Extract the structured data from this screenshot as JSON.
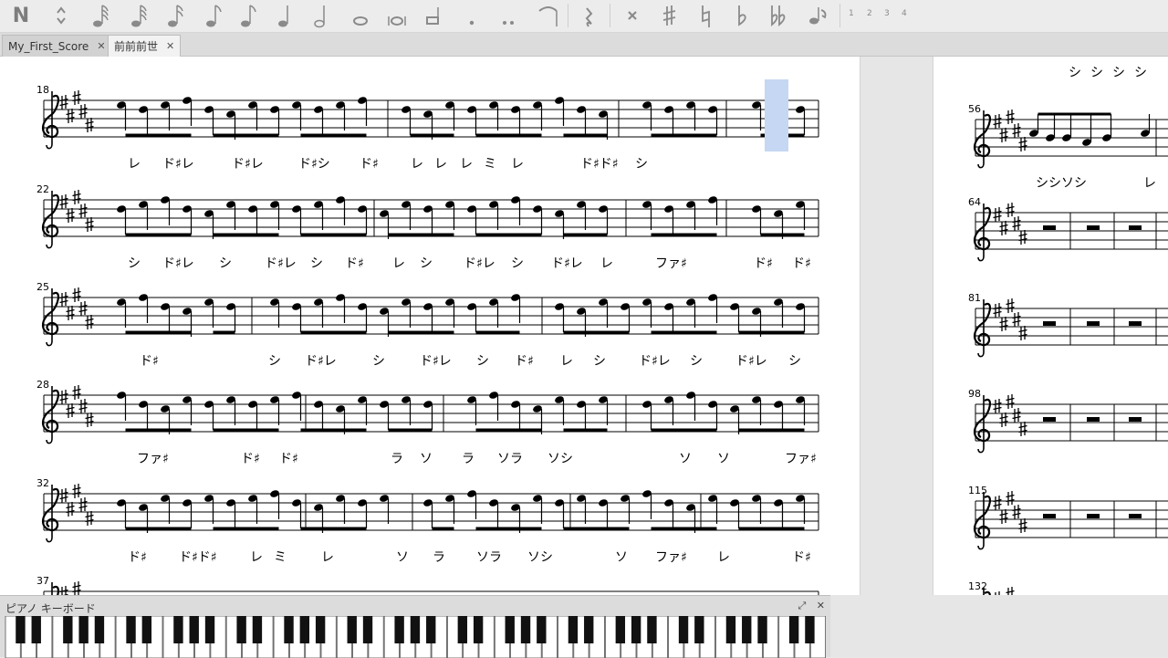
{
  "toolbar": {
    "note_input_icon": "N",
    "tuplet_counts": [
      "1",
      "2",
      "3",
      "4"
    ]
  },
  "tabs": [
    {
      "label": "My_First_Score",
      "close": "✕",
      "active": false
    },
    {
      "label": "前前前世",
      "close": "✕",
      "active": true
    }
  ],
  "score": {
    "systems": [
      {
        "measure_number": "18",
        "lyrics": [
          "レ",
          "ド♯レ",
          "ド♯レ",
          "ド♯シ",
          "ド♯",
          "レ",
          "レ",
          "レ",
          "ミ",
          "レ",
          "ド♯ド♯",
          "シ"
        ]
      },
      {
        "measure_number": "22",
        "lyrics": [
          "シ",
          "ド♯レ",
          "シ",
          "ド♯レ",
          "シ",
          "ド♯",
          "レ",
          "シ",
          "ド♯レ",
          "シ",
          "ド♯レ",
          "レ",
          "ファ♯",
          "ド♯",
          "ド♯"
        ]
      },
      {
        "measure_number": "25",
        "lyrics": [
          "ド♯",
          "シ",
          "ド♯レ",
          "シ",
          "ド♯レ",
          "シ",
          "ド♯",
          "レ",
          "シ",
          "ド♯レ",
          "シ",
          "ド♯レ",
          "シ"
        ]
      },
      {
        "measure_number": "28",
        "lyrics": [
          "ファ♯",
          "ド♯",
          "ド♯",
          "ラ",
          "ソ",
          "ラ",
          "ソラ",
          "ソシ",
          "ソ",
          "ソ",
          "ファ♯"
        ]
      },
      {
        "measure_number": "32",
        "lyrics": [
          "ド♯",
          "ド♯ド♯",
          "レ",
          "ミ",
          "レ",
          "ソ",
          "ラ",
          "ソラ",
          "ソシ",
          "ソ",
          "ファ♯",
          "レ",
          "ド♯"
        ]
      },
      {
        "measure_number": "37",
        "lyrics": []
      }
    ],
    "page2": {
      "top_lyrics": [
        "シ",
        "シ",
        "シ",
        "シ"
      ],
      "systems": [
        {
          "measure_number": "56",
          "lyrics": [
            "シシソシ",
            "レ"
          ]
        },
        {
          "measure_number": "64",
          "lyrics": []
        },
        {
          "measure_number": "81",
          "lyrics": []
        },
        {
          "measure_number": "98",
          "lyrics": []
        },
        {
          "measure_number": "115",
          "lyrics": []
        },
        {
          "measure_number": "132",
          "lyrics": []
        }
      ]
    }
  },
  "piano": {
    "title": "ピアノ キーボード",
    "controls": [
      "⤢",
      "✕"
    ],
    "white_key_count": 52
  },
  "colors": {
    "selection": "#c5d7f2",
    "toolbar_icon": "#7d7d7d"
  }
}
